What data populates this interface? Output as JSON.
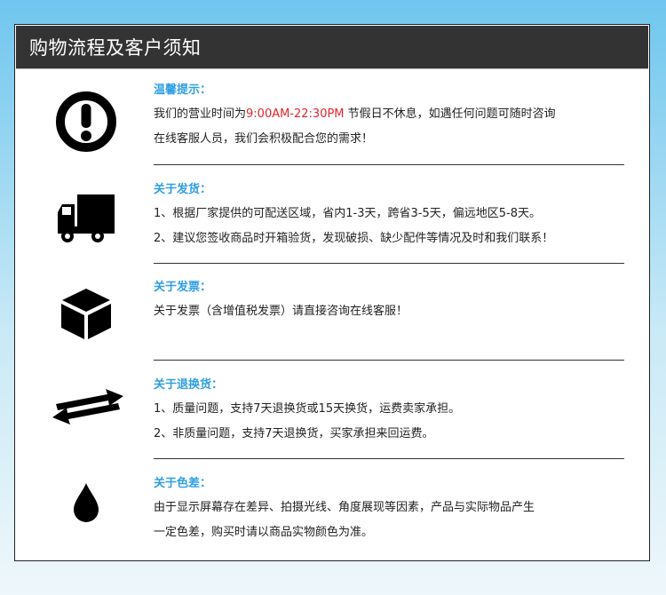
{
  "header": {
    "title": "购物流程及客户须知"
  },
  "sections": [
    {
      "title": "温馨提示：",
      "lines": [
        {
          "pre": "我们的营业时间为",
          "hl": "9:00AM-22:30PM",
          "post": " 节假日不休息，如遇任何问题可随时咨询"
        },
        {
          "pre": "在线客服人员，我们会积极配合您的需求！"
        }
      ]
    },
    {
      "title": "关于发货：",
      "lines": [
        {
          "pre": "1、根据厂家提供的可配送区域，省内1-3天，跨省3-5天，偏远地区5-8天。"
        },
        {
          "pre": "2、建议您签收商品时开箱验货，发现破损、缺少配件等情况及时和我们联系！"
        }
      ]
    },
    {
      "title": "关于发票：",
      "lines": [
        {
          "pre": "关于发票（含增值税发票）请直接咨询在线客服！"
        }
      ]
    },
    {
      "title": "关于退换货：",
      "lines": [
        {
          "pre": "1、质量问题，支持7天退换货或15天换货，运费卖家承担。"
        },
        {
          "pre": "2、非质量问题，支持7天退换货，买家承担来回运费。"
        }
      ]
    },
    {
      "title": "关于色差：",
      "lines": [
        {
          "pre": "由于显示屏幕存在差异、拍摄光线、角度展现等因素，产品与实际物品产生"
        },
        {
          "pre": "一定色差，购买时请以商品实物颜色为准。"
        }
      ]
    }
  ],
  "colors": {
    "accent": "#2e9ee5",
    "highlight": "#e5242b",
    "header_bg": "#333333"
  },
  "icons": [
    "exclamation-circle-icon",
    "truck-icon",
    "box-icon",
    "exchange-arrows-icon",
    "drop-icon"
  ]
}
